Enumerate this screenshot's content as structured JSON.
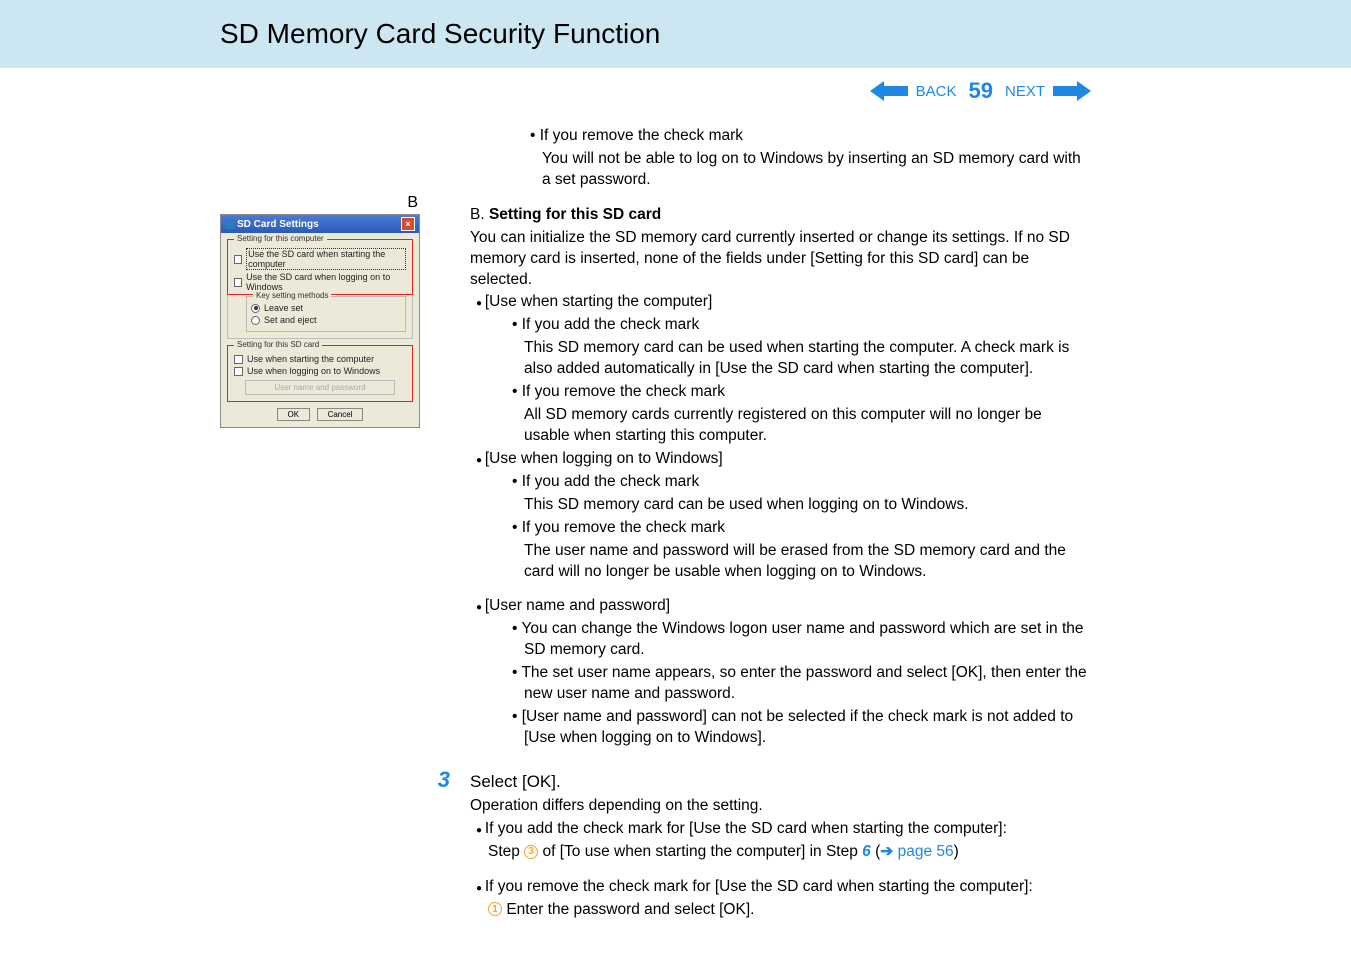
{
  "header": {
    "title": "SD Memory Card Security Function"
  },
  "nav": {
    "back": "BACK",
    "next": "NEXT",
    "page": "59"
  },
  "callout": {
    "label": "B"
  },
  "dialog": {
    "title": "SD Card Settings",
    "group1": {
      "legend": "Setting for this computer",
      "chk1": "Use the SD card when starting the computer",
      "chk2": "Use the SD card when logging on to Windows",
      "sub_legend": "Key setting methods",
      "radio1": "Leave set",
      "radio2": "Set and eject"
    },
    "group2": {
      "legend": "Setting for this SD card",
      "chk1": "Use when starting the computer",
      "chk2": "Use when logging on to Windows",
      "btn_user": "User name and password"
    },
    "btn_ok": "OK",
    "btn_cancel": "Cancel"
  },
  "content": {
    "if_remove_top": "If you remove the check mark",
    "remove_top_body": "You will not be able to log on to Windows by inserting an SD memory card with a set password.",
    "b_label": "B.",
    "b_title": "Setting for this SD card",
    "b_desc": "You can initialize the SD memory card currently inserted or change its settings. If no SD memory card is inserted, none of the fields under [Setting for this SD card] can be selected.",
    "use_start": "[Use when starting the computer]",
    "if_add": "If you add the check mark",
    "add_start_body": "This SD memory card can be used when starting the computer. A check mark is also added automatically in [Use the SD card when starting the computer].",
    "if_remove": "If you remove the check mark",
    "remove_start_body": "All SD memory cards currently registered on this computer will no longer be usable when starting this computer.",
    "use_logon": "[Use when logging on to Windows]",
    "add_logon_body": "This SD memory card can be used when logging on to Windows.",
    "remove_logon_body": "The user name and password will be erased from the SD memory card and the card will no longer be usable when logging on to Windows.",
    "user_pw": "[User name and password]",
    "user_pw_1": "You can change the Windows logon user name and password which are set in the SD memory card.",
    "user_pw_2": "The set user name appears, so enter the password and select [OK], then enter the new user name and password.",
    "user_pw_3": "[User name and password] can not be selected if the check mark is not added to [Use when logging on to Windows].",
    "step3_title": "Select [OK].",
    "step3_sub": "Operation differs depending on the setting.",
    "step3_b1": "If you add the check mark for [Use the SD card when starting the computer]:",
    "step3_b1_a": "Step ",
    "step3_b1_b": " of [To use when starting the computer] in Step ",
    "step3_b1_num": "6",
    "step3_b1_link": "page 56",
    "step3_b2": "If you remove the check mark for [Use the SD card when starting the computer]:",
    "step3_b2_a": "Enter the password and select [OK]."
  }
}
